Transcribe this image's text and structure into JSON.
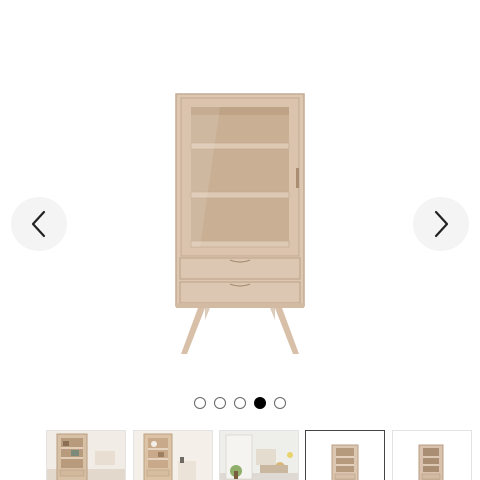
{
  "gallery": {
    "nav": {
      "prev_icon": "chevron-left-icon",
      "next_icon": "chevron-right-icon"
    },
    "dots": {
      "count": 5,
      "active_index": 3
    },
    "thumbnails": [
      {
        "name": "thumbnail-cabinet-room"
      },
      {
        "name": "thumbnail-cabinet-styled"
      },
      {
        "name": "thumbnail-room-scene"
      },
      {
        "name": "thumbnail-cabinet-front",
        "selected": true
      },
      {
        "name": "thumbnail-cabinet-side"
      }
    ],
    "colors": {
      "wood": "#dcc7b3",
      "wood_dark": "#c7ad94",
      "interior": "#cbb296",
      "active_dot": "#000000"
    }
  }
}
